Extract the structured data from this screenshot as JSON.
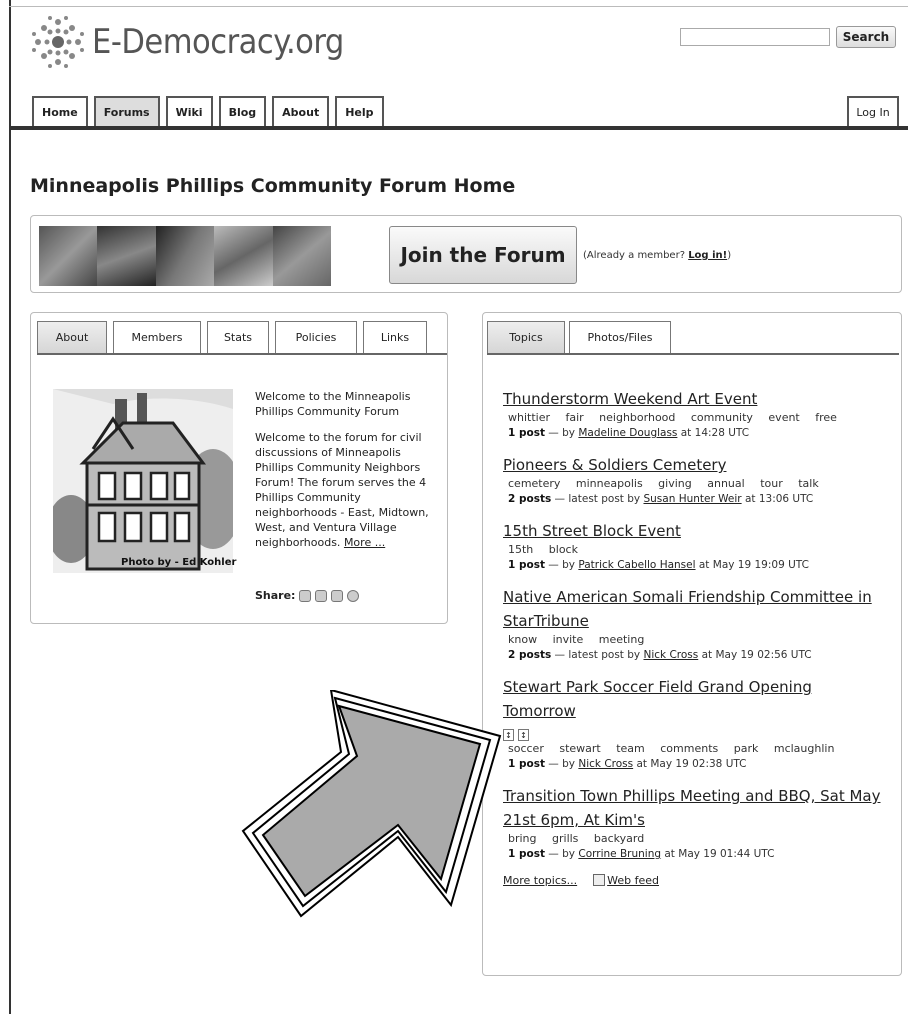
{
  "header": {
    "logo_text": "E-Democracy.org",
    "search_button": "Search",
    "search_placeholder": "",
    "nav": [
      "Home",
      "Forums",
      "Wiki",
      "Blog",
      "About",
      "Help"
    ],
    "active_nav": "Forums",
    "login": "Log In"
  },
  "page_title": "Minneapolis Phillips Community Forum Home",
  "banner": {
    "join_button": "Join the Forum",
    "already_prefix": "(Already a member? ",
    "already_link": "Log in!",
    "already_suffix": ")"
  },
  "left_panel": {
    "tabs": [
      "About",
      "Members",
      "Stats",
      "Policies",
      "Links"
    ],
    "active_tab": "About",
    "photo_caption": "Photo by - Ed Kohler",
    "welcome_heading": "Welcome to the Minneapolis Phillips Community Forum",
    "welcome_body": "Welcome to the forum for civil discussions of Minneapolis Phillips Community Neighbors Forum! The forum serves the 4 Phillips Community neighborhoods - East, Midtown, West, and Ventura Village neighborhoods.",
    "more_link": "More ...",
    "share_label": "Share:"
  },
  "right_panel": {
    "tabs": [
      "Topics",
      "Photos/Files"
    ],
    "active_tab": "Topics",
    "topics": [
      {
        "title": "Thunderstorm Weekend Art Event",
        "tags": "whittier fair neighborhood community event free",
        "count": "1 post",
        "by": " — by ",
        "author": "Madeline Douglass",
        "time": " at 14:28 UTC"
      },
      {
        "title": "Pioneers & Soldiers Cemetery",
        "tags": "cemetery minneapolis giving annual tour talk",
        "count": "2 posts",
        "by": " — latest post by ",
        "author": "Susan Hunter Weir",
        "time": " at 13:06 UTC"
      },
      {
        "title": "15th Street Block Event",
        "tags": "15th block",
        "count": "1 post",
        "by": " — by ",
        "author": "Patrick Cabello Hansel",
        "time": " at May 19 19:09 UTC"
      },
      {
        "title": "Native American Somali Friendship Committee in StarTribune",
        "tags": "know invite meeting",
        "count": "2 posts",
        "by": " — latest post by ",
        "author": "Nick Cross",
        "time": " at May 19 02:56 UTC"
      },
      {
        "title": "Stewart Park Soccer Field Grand Opening Tomorrow",
        "tags": "soccer stewart team comments park mclaughlin",
        "count": "1 post",
        "by": " — by ",
        "author": "Nick Cross",
        "time": " at May 19 02:38 UTC",
        "attachments": true
      },
      {
        "title": "Transition Town Phillips Meeting and BBQ, Sat May 21st 6pm, At Kim's",
        "tags": "bring grills backyard",
        "count": "1 post",
        "by": " — by ",
        "author": "Corrine Bruning",
        "time": " at May 19 01:44 UTC"
      }
    ],
    "more_topics": "More topics...",
    "web_feed": "Web feed"
  }
}
